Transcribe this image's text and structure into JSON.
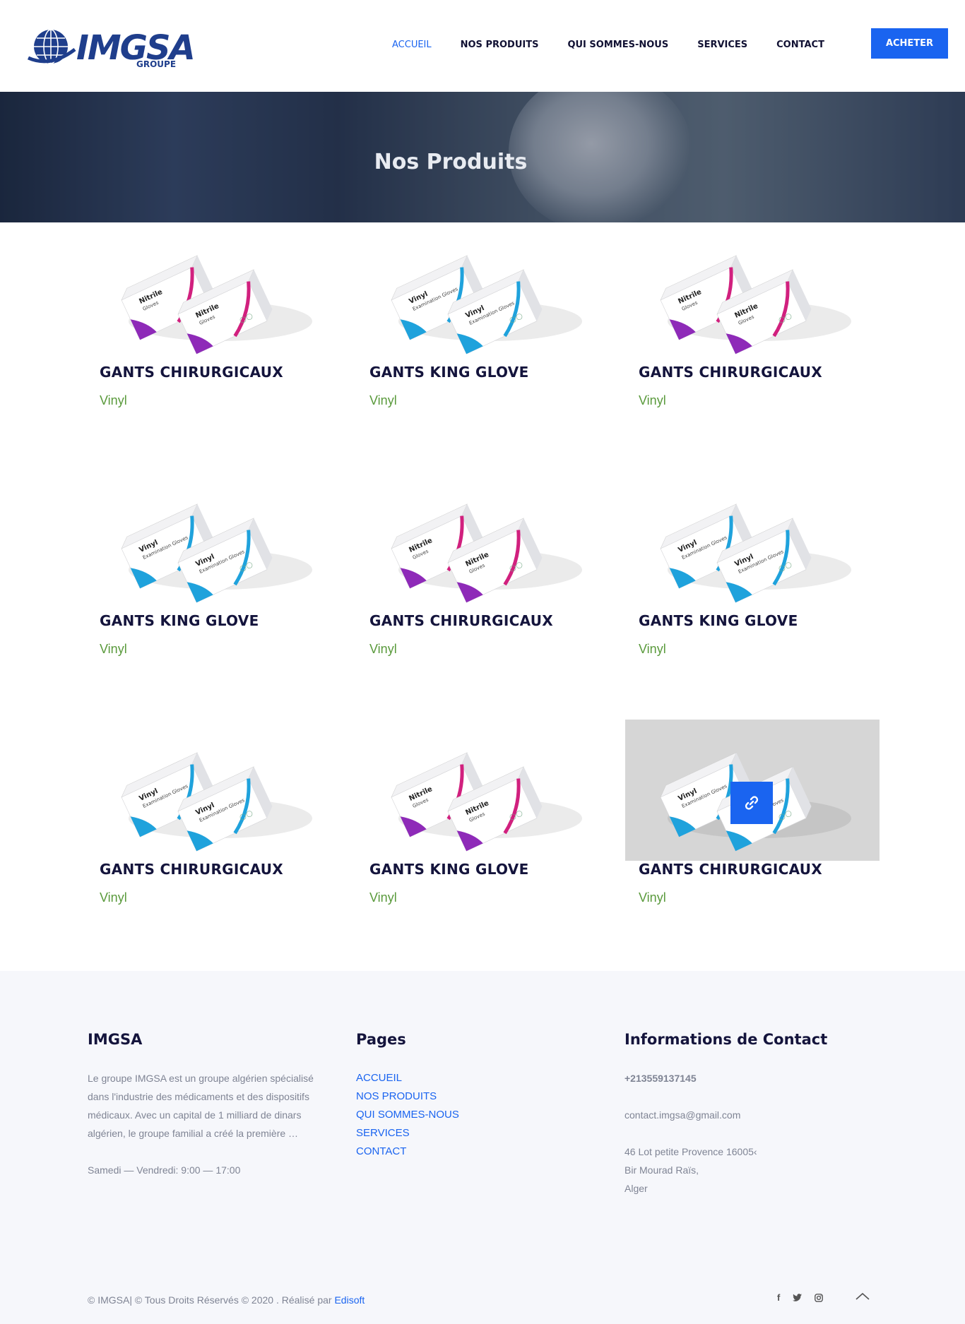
{
  "header": {
    "logo_text": "IMGSA",
    "logo_sub": "GROUPE",
    "nav": [
      {
        "label": "ACCUEIL",
        "active": true
      },
      {
        "label": "NOS PRODUITS",
        "active": false
      },
      {
        "label": "QUI SOMMES-NOUS",
        "active": false
      },
      {
        "label": "SERVICES",
        "active": false
      },
      {
        "label": "CONTACT",
        "active": false
      }
    ],
    "buy_label": "ACHETER"
  },
  "hero": {
    "title": "Nos Produits"
  },
  "products": [
    {
      "title": "GANTS CHIRURGICAUX",
      "subtitle": "Vinyl",
      "box": "Nitrile Gloves"
    },
    {
      "title": "GANTS KING GLOVE",
      "subtitle": "Vinyl",
      "box": "Vinyl Examination Gloves"
    },
    {
      "title": "GANTS CHIRURGICAUX",
      "subtitle": "Vinyl",
      "box": "Nitrile Gloves"
    },
    {
      "title": "GANTS KING GLOVE",
      "subtitle": "Vinyl",
      "box": "Vinyl Examination Gloves"
    },
    {
      "title": "GANTS CHIRURGICAUX",
      "subtitle": "Vinyl",
      "box": "Nitrile Gloves"
    },
    {
      "title": "GANTS KING GLOVE",
      "subtitle": "Vinyl",
      "box": "Vinyl Examination Gloves"
    },
    {
      "title": "GANTS CHIRURGICAUX",
      "subtitle": "Vinyl",
      "box": "Vinyl Examination Gloves"
    },
    {
      "title": "GANTS KING GLOVE",
      "subtitle": "Vinyl",
      "box": "Nitrile Gloves"
    },
    {
      "title": "GANTS CHIRURGICAUX",
      "subtitle": "Vinyl",
      "box": "Vinyl Examination Gloves",
      "hover": true
    }
  ],
  "footer": {
    "about": {
      "heading": "IMGSA",
      "text_lines": [
        "Le groupe IMGSA est un groupe algérien spécialisé",
        "dans l'industrie des médicaments et des dispositifs",
        "médicaux. Avec un capital de 1 milliard de dinars",
        "algérien, le groupe familial a créé la première …"
      ],
      "hours": "Samedi — Vendredi: 9:00 — 17:00"
    },
    "pages": {
      "heading": "Pages",
      "links": [
        "ACCUEIL",
        "NOS PRODUITS",
        "QUI SOMMES-NOUS",
        "SERVICES",
        "CONTACT"
      ]
    },
    "contact": {
      "heading": "Informations de Contact",
      "phone": "+213559137145",
      "email": "contact.imgsa@gmail.com",
      "address_lines": [
        "46 Lot petite Provence 16005‹",
        "Bir Mourad Raïs,",
        "Alger"
      ]
    },
    "copyright_prefix": "© IMGSA| © Tous Droits Réservés © 2020 . Réalisé par ",
    "copyright_link": "Edisoft",
    "socials": [
      "facebook-icon",
      "twitter-icon",
      "instagram-icon"
    ]
  },
  "colors": {
    "accent": "#1a64f0",
    "navy": "#14143c",
    "green": "#5a9a3c",
    "footer_bg": "#f6f7fb"
  }
}
